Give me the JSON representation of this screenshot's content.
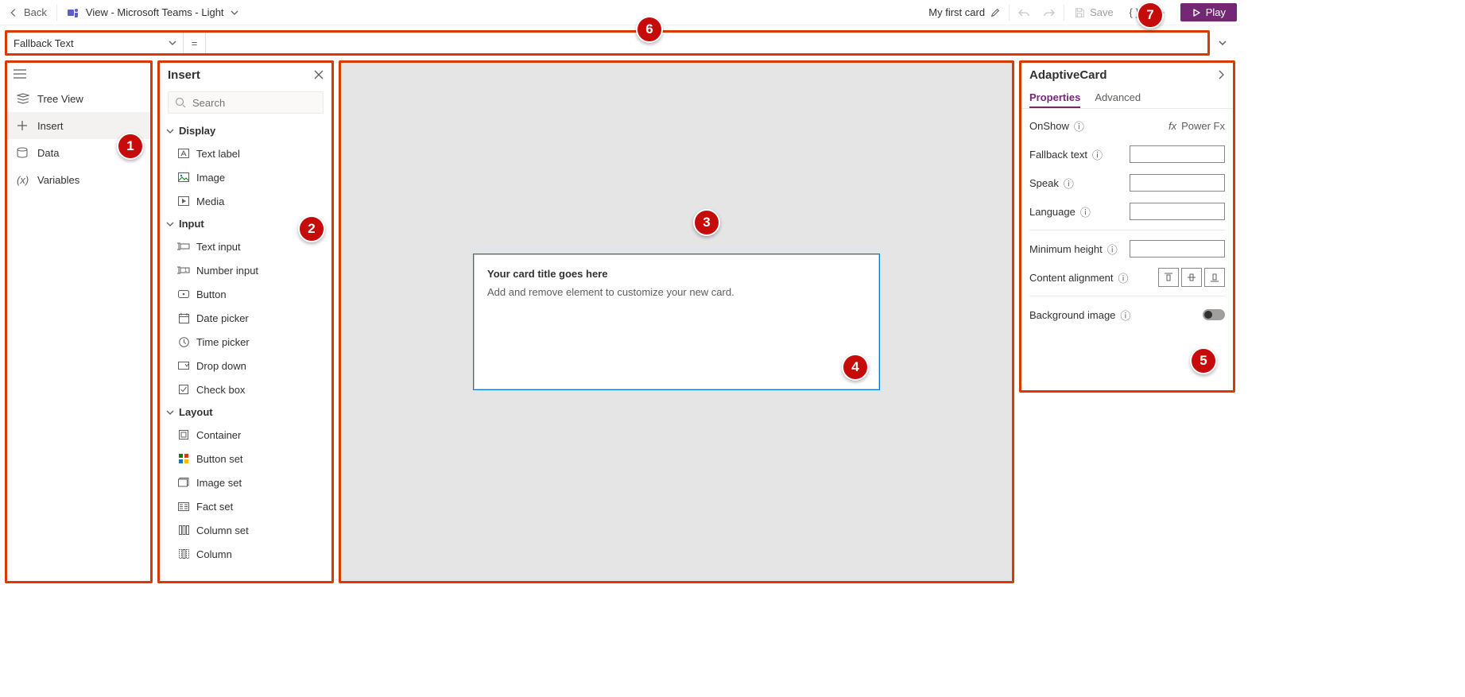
{
  "topbar": {
    "back": "Back",
    "view_label": "View - Microsoft Teams - Light",
    "card_name": "My first card",
    "save": "Save",
    "play": "Play"
  },
  "formula": {
    "property": "Fallback Text",
    "value": ""
  },
  "leftnav": {
    "items": [
      {
        "label": "Tree View"
      },
      {
        "label": "Insert"
      },
      {
        "label": "Data"
      },
      {
        "label": "Variables"
      }
    ]
  },
  "insert": {
    "title": "Insert",
    "search_placeholder": "Search",
    "groups": [
      {
        "label": "Display",
        "items": [
          {
            "label": "Text label"
          },
          {
            "label": "Image"
          },
          {
            "label": "Media"
          }
        ]
      },
      {
        "label": "Input",
        "items": [
          {
            "label": "Text input"
          },
          {
            "label": "Number input"
          },
          {
            "label": "Button"
          },
          {
            "label": "Date picker"
          },
          {
            "label": "Time picker"
          },
          {
            "label": "Drop down"
          },
          {
            "label": "Check box"
          }
        ]
      },
      {
        "label": "Layout",
        "items": [
          {
            "label": "Container"
          },
          {
            "label": "Button set"
          },
          {
            "label": "Image set"
          },
          {
            "label": "Fact set"
          },
          {
            "label": "Column set"
          },
          {
            "label": "Column"
          }
        ]
      }
    ]
  },
  "card": {
    "title": "Your card title goes here",
    "body": "Add and remove element to customize your new card."
  },
  "properties": {
    "title": "AdaptiveCard",
    "tabs": {
      "properties": "Properties",
      "advanced": "Advanced"
    },
    "rows": {
      "onshow": "OnShow",
      "powerfx": "Power Fx",
      "fallback": "Fallback text",
      "speak": "Speak",
      "language": "Language",
      "minheight": "Minimum height",
      "alignment": "Content alignment",
      "bgimage": "Background image"
    }
  },
  "callouts": {
    "c1": "1",
    "c2": "2",
    "c3": "3",
    "c4": "4",
    "c5": "5",
    "c6": "6",
    "c7": "7"
  }
}
